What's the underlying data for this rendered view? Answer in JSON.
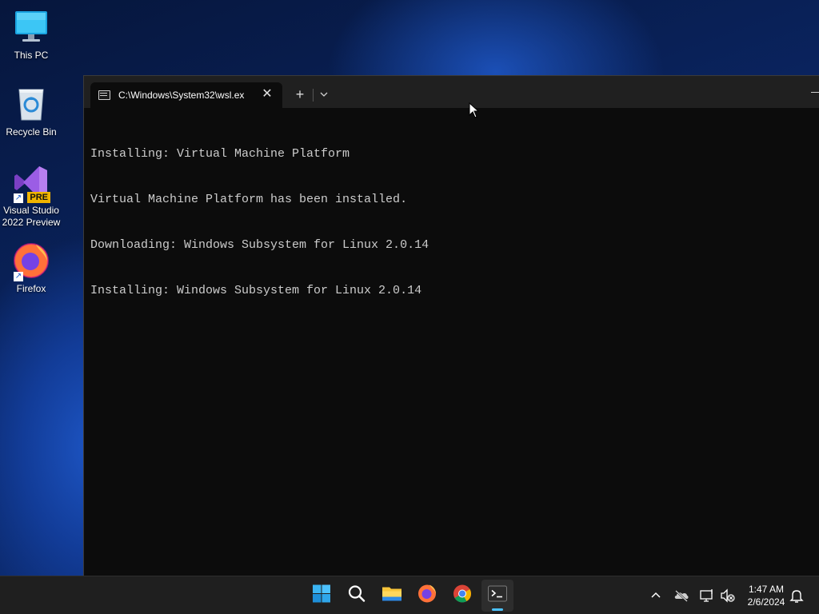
{
  "desktop": {
    "icons": [
      {
        "label": "This PC",
        "icon": "monitor-icon"
      },
      {
        "label": "Recycle Bin",
        "icon": "recycle-bin-icon"
      },
      {
        "label": "Visual Studio 2022 Preview",
        "icon": "visual-studio-icon",
        "badge": "PRE"
      },
      {
        "label": "Firefox",
        "icon": "firefox-icon"
      }
    ]
  },
  "terminal": {
    "tab_title": "C:\\Windows\\System32\\wsl.ex",
    "new_tab_label": "+",
    "close_label": "✕",
    "lines": [
      "Installing: Virtual Machine Platform",
      "Virtual Machine Platform has been installed.",
      "Downloading: Windows Subsystem for Linux 2.0.14",
      "Installing: Windows Subsystem for Linux 2.0.14"
    ]
  },
  "taskbar": {
    "pinned": [
      "start-icon",
      "search-icon",
      "file-explorer-icon",
      "firefox-icon",
      "chrome-icon",
      "terminal-icon"
    ],
    "tray": [
      "chevron-up-icon",
      "onedrive-offline-icon",
      "network-icon",
      "volume-muted-icon",
      "notification-bell-icon"
    ],
    "time": "1:47 AM",
    "date": "2/6/2024"
  },
  "colors": {
    "terminal_bg": "#0c0c0c",
    "terminal_fg": "#cccccc",
    "titlebar_bg": "#202020",
    "taskbar_bg": "#1f1f1f",
    "accent": "#4cc2ff"
  }
}
